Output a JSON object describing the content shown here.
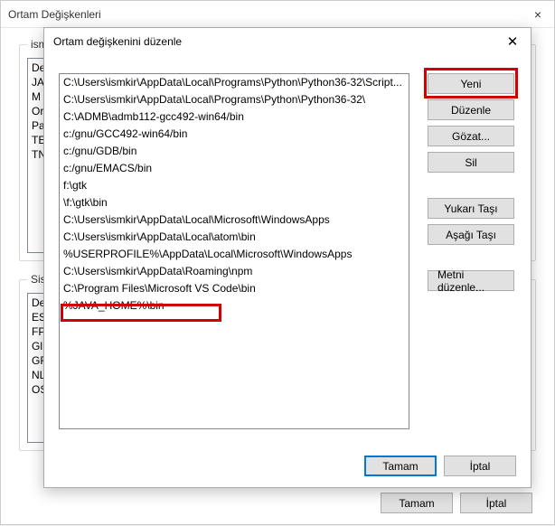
{
  "back": {
    "title": "Ortam Değişkenleri",
    "group_user_label": "ismk",
    "group_sys_label": "Siste",
    "user_vars": [
      "De",
      "JA",
      "M",
      "Or",
      "Pa",
      "TE",
      "TN"
    ],
    "sys_vars": [
      "De",
      "ES",
      "FP",
      "Gl",
      "GF",
      "NL",
      "OS"
    ],
    "buttons": {
      "ok": "Tamam",
      "cancel": "İptal"
    }
  },
  "front": {
    "title": "Ortam değişkenini düzenle",
    "entries": [
      "C:\\Users\\ismkir\\AppData\\Local\\Programs\\Python\\Python36-32\\Script...",
      "C:\\Users\\ismkir\\AppData\\Local\\Programs\\Python\\Python36-32\\",
      "C:\\ADMB\\admb112-gcc492-win64/bin",
      "c:/gnu/GCC492-win64/bin",
      "c:/gnu/GDB/bin",
      "c:/gnu/EMACS/bin",
      "f:\\gtk",
      "\\f:\\gtk\\bin",
      "C:\\Users\\ismkir\\AppData\\Local\\Microsoft\\WindowsApps",
      "C:\\Users\\ismkir\\AppData\\Local\\atom\\bin",
      "%USERPROFILE%\\AppData\\Local\\Microsoft\\WindowsApps",
      "C:\\Users\\ismkir\\AppData\\Roaming\\npm",
      "C:\\Program Files\\Microsoft VS Code\\bin",
      "%JAVA_HOME%\\bin"
    ],
    "buttons": {
      "new": "Yeni",
      "edit": "Düzenle",
      "browse": "Gözat...",
      "delete": "Sil",
      "move_up": "Yukarı Taşı",
      "move_down": "Aşağı Taşı",
      "edit_text": "Metni düzenle...",
      "ok": "Tamam",
      "cancel": "İptal"
    }
  }
}
